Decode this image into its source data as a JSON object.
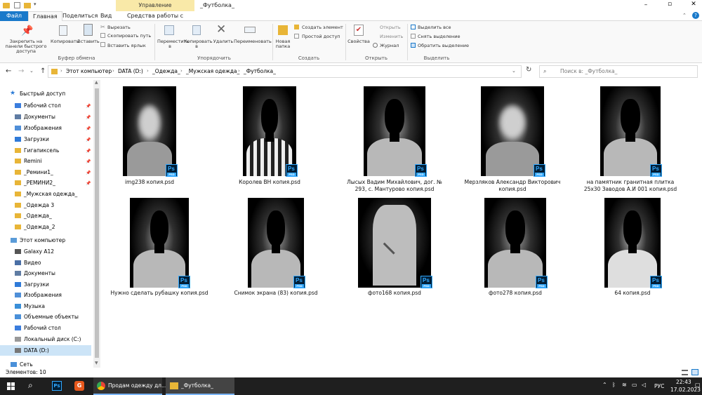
{
  "window": {
    "title": "_Футболка_",
    "context_tab": "Управление"
  },
  "tabs": [
    "Файл",
    "Главная",
    "Поделиться",
    "Вид",
    "Средства работы с рисунками"
  ],
  "ribbon": {
    "pin_label": "Закрепить на панели быстрого доступа",
    "copy": "Копировать",
    "paste": "Вставить",
    "cut": "Вырезать",
    "copy_path": "Скопировать путь",
    "paste_shortcut": "Вставить ярлык",
    "clipboard_group": "Буфер обмена",
    "move_to": "Переместить в",
    "copy_to": "Копировать в",
    "delete": "Удалить",
    "rename": "Переименовать",
    "organize_group": "Упорядочить",
    "new_folder": "Новая папка",
    "new_item": "Создать элемент",
    "easy_access": "Простой доступ",
    "create_group": "Создать",
    "properties": "Свойства",
    "open": "Открыть",
    "edit": "Изменить",
    "history": "Журнал",
    "open_group": "Открыть",
    "select_all": "Выделить все",
    "select_none": "Снять выделение",
    "invert": "Обратить выделение",
    "select_group": "Выделить"
  },
  "address": {
    "crumbs": [
      "Этот компьютер",
      "DATA (D:)",
      "_Одежда_",
      "_Мужская одежда_",
      "_Футболка_"
    ],
    "search_placeholder": "Поиск в: _Футболка_"
  },
  "nav": {
    "quick_access": "Быстрый доступ",
    "items": [
      {
        "label": "Рабочий стол",
        "pinned": true
      },
      {
        "label": "Документы",
        "pinned": true
      },
      {
        "label": "Изображения",
        "pinned": true
      },
      {
        "label": "Загрузки",
        "pinned": true
      },
      {
        "label": "Гигапиксель",
        "pinned": true
      },
      {
        "label": "Remini",
        "pinned": true
      },
      {
        "label": "_Ремини1_",
        "pinned": true
      },
      {
        "label": "_РЕМИНИ2_",
        "pinned": true
      },
      {
        "label": "_Мужская одежда_",
        "pinned": false
      },
      {
        "label": "_Одежда 3",
        "pinned": false
      },
      {
        "label": "_Одежда_",
        "pinned": false
      },
      {
        "label": "_Одежда_2",
        "pinned": false
      }
    ],
    "this_pc": "Этот компьютер",
    "pc_items": [
      "Galaxy A12",
      "Видео",
      "Документы",
      "Загрузки",
      "Изображения",
      "Музыка",
      "Объемные объекты",
      "Рабочий стол",
      "Локальный диск (C:)",
      "DATA (D:)"
    ],
    "network": "Сеть"
  },
  "files": [
    {
      "name": "img238 копия.psd"
    },
    {
      "name": "Королев ВН копия.psd"
    },
    {
      "name": "Лысых Вадим Михайлович, дог. № 293, с. Мантурово копия.psd"
    },
    {
      "name": "Мерзляков Александр Викторович копия.psd"
    },
    {
      "name": "на памятник гранитная плитка 25х30 Заводов А.И 001 копия.psd"
    },
    {
      "name": "Нужно сделать рубашку копия.psd"
    },
    {
      "name": "Снимок экрана (83) копия.psd"
    },
    {
      "name": "фото168 копия.psd"
    },
    {
      "name": "фото278 копия.psd"
    },
    {
      "name": "64 копия.psd"
    }
  ],
  "status": {
    "count": "Элементов: 10"
  },
  "taskbar": {
    "chrome_label": "Продам одежду дл...",
    "explorer_label": "_Футболка_",
    "lang": "РУС",
    "time": "22:43",
    "date": "17.02.2023"
  }
}
